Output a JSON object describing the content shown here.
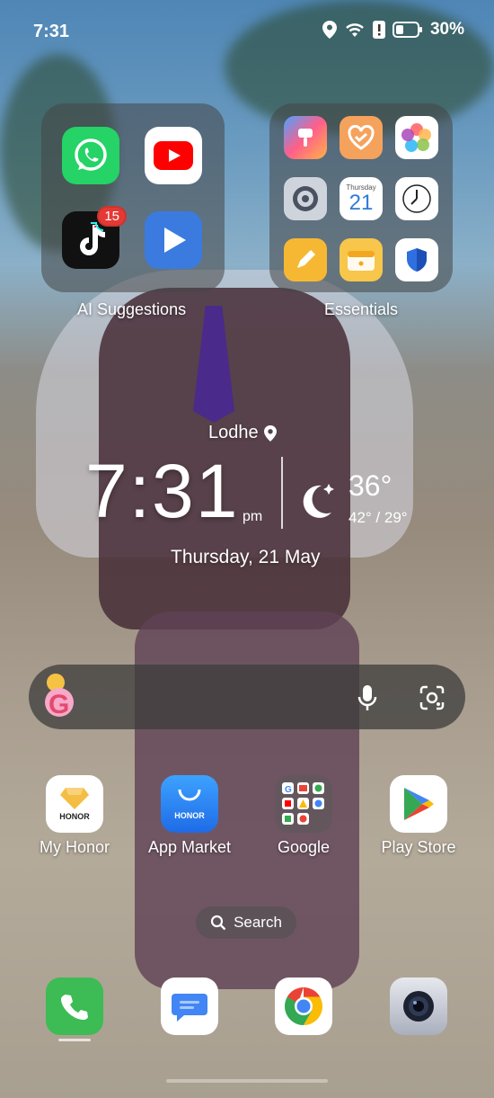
{
  "status_bar": {
    "time": "7:31",
    "battery": "30%"
  },
  "folders": [
    {
      "label": "AI Suggestions",
      "apps": [
        {
          "name": "WhatsApp"
        },
        {
          "name": "YouTube"
        },
        {
          "name": "TikTok",
          "badge": "15"
        },
        {
          "name": "Video Player"
        }
      ]
    },
    {
      "label": "Essentials",
      "apps": [
        {
          "name": "Themes"
        },
        {
          "name": "Health"
        },
        {
          "name": "Gallery"
        },
        {
          "name": "Settings"
        },
        {
          "name": "Calendar",
          "weekday": "Thursday",
          "day": "21"
        },
        {
          "name": "Clock"
        },
        {
          "name": "Notes"
        },
        {
          "name": "Files"
        },
        {
          "name": "Optimizer"
        }
      ]
    }
  ],
  "clock_widget": {
    "location": "Lodhe",
    "time": "7:31",
    "ampm": "pm",
    "temperature": "36°",
    "range": "42° / 29°",
    "date": "Thursday, 21 May"
  },
  "apps_row": [
    {
      "label": "My Honor",
      "icon_text": "HONOR"
    },
    {
      "label": "App Market",
      "icon_text": "HONOR"
    },
    {
      "label": "Google"
    },
    {
      "label": "Play Store"
    }
  ],
  "search_pill": {
    "label": "Search"
  },
  "dock": [
    {
      "name": "Phone"
    },
    {
      "name": "Messages"
    },
    {
      "name": "Chrome"
    },
    {
      "name": "Camera"
    }
  ],
  "colors": {
    "whatsapp": "#25D366",
    "youtube": "#FF0000",
    "play": "#3b7be0",
    "phone": "#3dbb54"
  }
}
